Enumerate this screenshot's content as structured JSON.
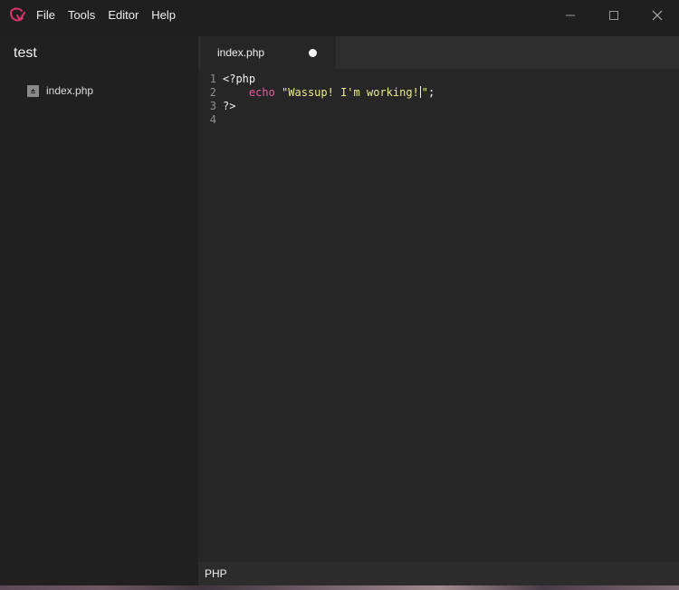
{
  "window": {
    "menu": [
      "File",
      "Tools",
      "Editor",
      "Help"
    ],
    "controls": [
      "minimize",
      "maximize",
      "close"
    ]
  },
  "sidebar": {
    "project": "test",
    "files": [
      {
        "name": "index.php",
        "icon": "php-file-icon"
      }
    ]
  },
  "editor": {
    "tabs": [
      {
        "label": "index.php",
        "modified": true
      }
    ],
    "lines": [
      {
        "num": "1",
        "code": "<?php"
      },
      {
        "num": "2",
        "keyword": "echo",
        "string_before_cursor": "\"Wassup! I'm working!",
        "string_after_cursor": "\"",
        "tail": ";"
      },
      {
        "num": "3",
        "code": "?>"
      },
      {
        "num": "4",
        "code": ""
      }
    ]
  },
  "status": {
    "language": "PHP"
  },
  "colors": {
    "accent": "#e0336f",
    "keyword": "#e85a9a",
    "string": "#ecec8a",
    "background": "#262626"
  }
}
